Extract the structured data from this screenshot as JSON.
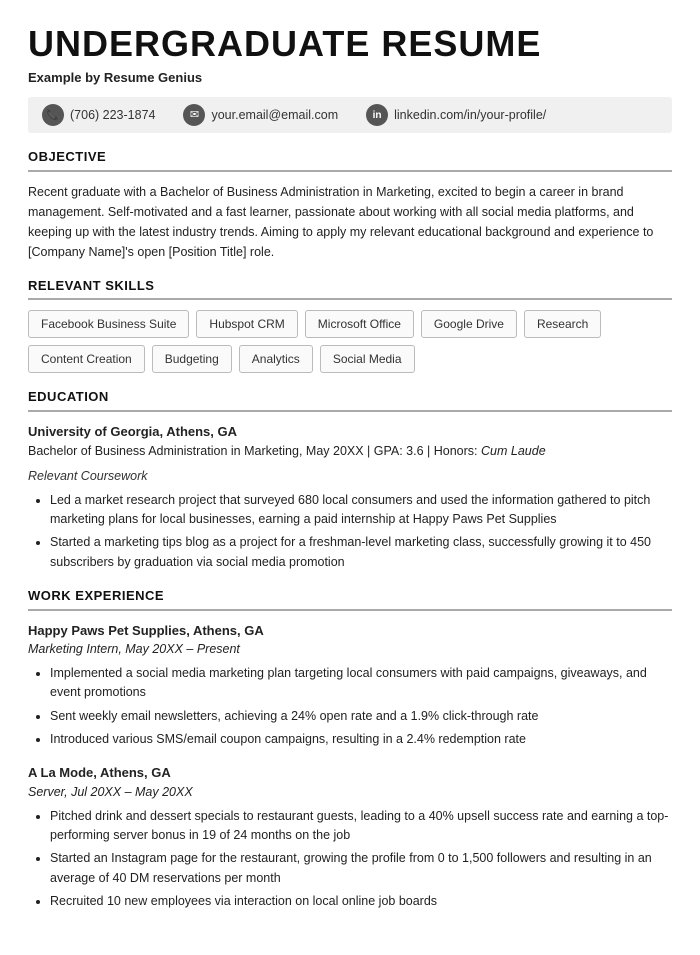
{
  "resume": {
    "title": "UNDERGRADUATE RESUME",
    "subtitle": "Example by Resume Genius",
    "contact": {
      "phone": "(706) 223-1874",
      "email": "your.email@email.com",
      "linkedin": "linkedin.com/in/your-profile/"
    },
    "sections": {
      "objective": {
        "heading": "OBJECTIVE",
        "text": "Recent graduate with a Bachelor of Business Administration in Marketing, excited to begin a career in brand management. Self-motivated and a fast learner, passionate about working with all social media platforms, and keeping up with the latest industry trends. Aiming to apply my relevant educational background and experience to [Company Name]'s open [Position Title] role."
      },
      "skills": {
        "heading": "RELEVANT SKILLS",
        "tags": [
          "Facebook Business Suite",
          "Hubspot CRM",
          "Microsoft Office",
          "Google Drive",
          "Research",
          "Content Creation",
          "Budgeting",
          "Analytics",
          "Social Media"
        ]
      },
      "education": {
        "heading": "EDUCATION",
        "school": "University of Georgia, Athens, GA",
        "degree": "Bachelor of Business Administration in Marketing, May 20XX | GPA: 3.6 | Honors:",
        "honors": "Cum Laude",
        "coursework_label": "Relevant Coursework",
        "bullets": [
          "Led a market research project that surveyed 680 local consumers and used the information gathered to pitch marketing plans for local businesses, earning a paid internship at Happy Paws Pet Supplies",
          "Started a marketing tips blog as a project for a freshman-level marketing class, successfully growing it to 450 subscribers by graduation via social media promotion"
        ]
      },
      "work": {
        "heading": "WORK EXPERIENCE",
        "jobs": [
          {
            "employer": "Happy Paws Pet Supplies, Athens, GA",
            "title": "Marketing Intern, May 20XX – Present",
            "bullets": [
              "Implemented a social media marketing plan targeting local consumers with paid campaigns, giveaways, and event promotions",
              "Sent weekly email newsletters, achieving a 24% open rate and a 1.9% click-through rate",
              "Introduced various SMS/email coupon campaigns, resulting in a 2.4% redemption rate"
            ]
          },
          {
            "employer": "A La Mode, Athens, GA",
            "title": "Server, Jul 20XX – May 20XX",
            "bullets": [
              "Pitched drink and dessert specials to restaurant guests, leading to a 40% upsell success rate and earning a top-performing server bonus in 19 of 24 months on the job",
              "Started an Instagram page for the restaurant, growing the profile from 0 to 1,500 followers and resulting in an average of 40 DM reservations per month",
              "Recruited 10 new employees via interaction on local online job boards"
            ]
          }
        ]
      }
    }
  }
}
